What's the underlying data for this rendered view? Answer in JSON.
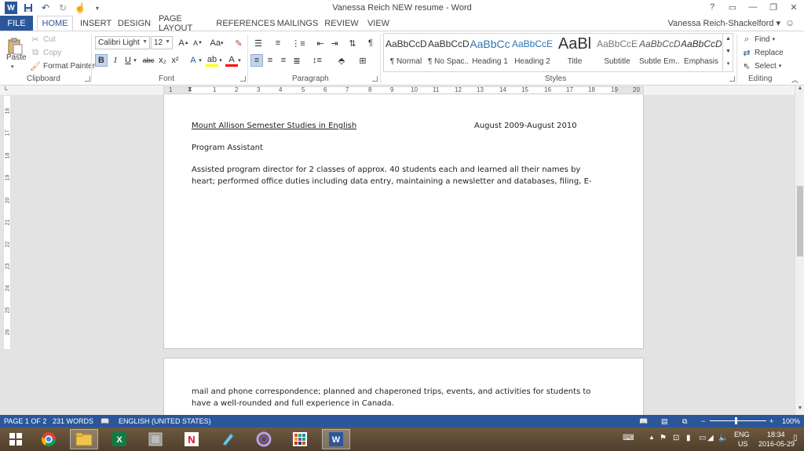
{
  "window": {
    "title": "Vanessa Reich NEW resume - Word",
    "user_name": "Vanessa Reich-Shackelford",
    "help": "?"
  },
  "tabs": [
    "FILE",
    "HOME",
    "INSERT",
    "DESIGN",
    "PAGE LAYOUT",
    "REFERENCES",
    "MAILINGS",
    "REVIEW",
    "VIEW"
  ],
  "clipboard": {
    "paste": "Paste",
    "cut": "Cut",
    "copy": "Copy",
    "format_painter": "Format Painter",
    "label": "Clipboard"
  },
  "font": {
    "name": "Calibri Light",
    "size": "12",
    "label": "Font",
    "grow": "A",
    "shrink": "A",
    "case": "Aa",
    "bold": "B",
    "italic": "I",
    "underline": "U",
    "strikethrough": "abc",
    "subscript": "x₂",
    "superscript": "x²"
  },
  "paragraph": {
    "label": "Paragraph",
    "show_marks": "¶"
  },
  "styles": {
    "label": "Styles",
    "items": [
      {
        "sample": "AaBbCcDc",
        "name": "¶ Normal"
      },
      {
        "sample": "AaBbCcDc",
        "name": "¶ No Spac..."
      },
      {
        "sample": "AaBbCc",
        "name": "Heading 1"
      },
      {
        "sample": "AaBbCcE",
        "name": "Heading 2"
      },
      {
        "sample": "AaBl",
        "name": "Title"
      },
      {
        "sample": "AaBbCcE",
        "name": "Subtitle"
      },
      {
        "sample": "AaBbCcDc",
        "name": "Subtle Em..."
      },
      {
        "sample": "AaBbCcDc",
        "name": "Emphasis"
      }
    ]
  },
  "editing": {
    "find": "Find",
    "replace": "Replace",
    "select": "Select",
    "label": "Editing"
  },
  "ruler_numbers": [
    "1",
    "1",
    "2",
    "3",
    "4",
    "5",
    "6",
    "7",
    "8",
    "9",
    "10",
    "11",
    "12",
    "13",
    "14",
    "15",
    "16",
    "17",
    "18",
    "19",
    "20"
  ],
  "vruler_numbers": [
    "16",
    "17",
    "18",
    "19",
    "20",
    "21",
    "22",
    "23",
    "24",
    "25",
    "26"
  ],
  "document": {
    "heading": "Mount Allison Semester Studies in English",
    "dates": "August 2009-August 2010",
    "role": "Program Assistant",
    "line1": "Assisted program director for 2 classes of approx. 40 students each and learned all their names by",
    "line2": "heart; performed office duties including data entry, maintaining a newsletter and databases, filing, E-",
    "line3": "mail and phone correspondence; planned and chaperoned trips, events, and activities for students to",
    "line4": "have a well-rounded and full experience in Canada."
  },
  "status": {
    "page": "PAGE 1 OF 2",
    "words": "231 WORDS",
    "language": "ENGLISH (UNITED STATES)",
    "zoom": "100%",
    "zoom_minus": "−",
    "zoom_plus": "+"
  },
  "taskbar": {
    "lang": "ENG",
    "region": "US",
    "time": "18:34",
    "date": "2016-05-29"
  },
  "colors": {
    "accent": "#2b579a",
    "highlight": "#ffff00",
    "font_color": "#ff0000"
  }
}
